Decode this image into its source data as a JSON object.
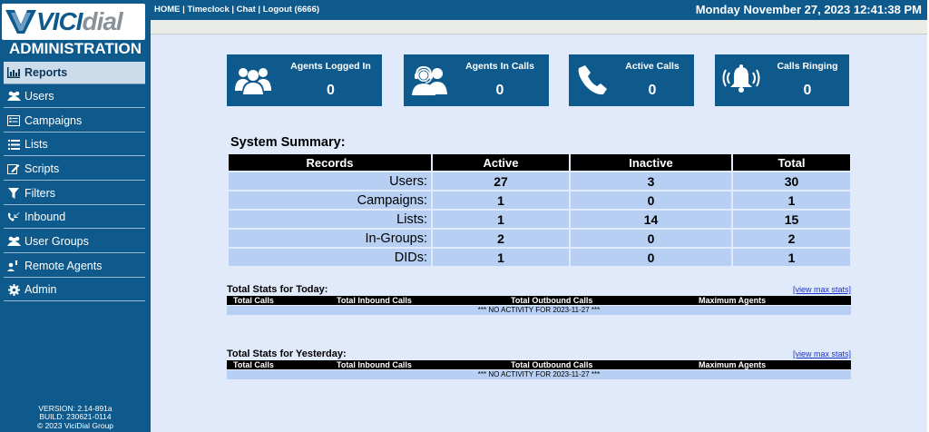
{
  "logo": {
    "brand_bold": "VICI",
    "brand_light": "dial"
  },
  "sidebar": {
    "title": "ADMINISTRATION",
    "items": [
      {
        "label": "Reports",
        "icon": "bar-chart-icon",
        "active": true
      },
      {
        "label": "Users",
        "icon": "users-icon"
      },
      {
        "label": "Campaigns",
        "icon": "campaigns-icon"
      },
      {
        "label": "Lists",
        "icon": "list-icon"
      },
      {
        "label": "Scripts",
        "icon": "script-edit-icon"
      },
      {
        "label": "Filters",
        "icon": "filter-icon"
      },
      {
        "label": "Inbound",
        "icon": "inbound-call-icon"
      },
      {
        "label": "User Groups",
        "icon": "users-icon"
      },
      {
        "label": "Remote Agents",
        "icon": "remote-agent-icon"
      },
      {
        "label": "Admin",
        "icon": "gear-icon"
      }
    ],
    "version": "VERSION: 2.14-891a",
    "build": "BUILD: 230621-0114",
    "copyright": "© 2023 ViciDial Group"
  },
  "topbar": {
    "links": [
      "HOME",
      "Timeclock",
      "Chat",
      "Logout (6666)"
    ],
    "separator": " | ",
    "datetime": "Monday November 27, 2023 12:41:38 PM"
  },
  "cards": [
    {
      "label": "Agents Logged In",
      "value": "0",
      "icon": "agents-group-icon"
    },
    {
      "label": "Agents In Calls",
      "value": "0",
      "icon": "headset-agents-icon"
    },
    {
      "label": "Active Calls",
      "value": "0",
      "icon": "phone-icon"
    },
    {
      "label": "Calls Ringing",
      "value": "0",
      "icon": "ringing-bell-icon"
    }
  ],
  "summary": {
    "title": "System Summary:",
    "headers": [
      "Records",
      "Active",
      "Inactive",
      "Total"
    ],
    "rows": [
      {
        "label": "Users:",
        "active": "27",
        "inactive": "3",
        "total": "30"
      },
      {
        "label": "Campaigns:",
        "active": "1",
        "inactive": "0",
        "total": "1"
      },
      {
        "label": "Lists:",
        "active": "1",
        "inactive": "14",
        "total": "15"
      },
      {
        "label": "In-Groups:",
        "active": "2",
        "inactive": "0",
        "total": "2"
      },
      {
        "label": "DIDs:",
        "active": "1",
        "inactive": "0",
        "total": "1"
      }
    ]
  },
  "today": {
    "title": "Total Stats for Today:",
    "link": "[view max stats]",
    "headers": [
      "Total Calls",
      "Total Inbound Calls",
      "Total Outbound Calls",
      "Maximum Agents"
    ],
    "message": "*** NO ACTIVITY FOR 2023-11-27 ***"
  },
  "yesterday": {
    "title": "Total Stats for Yesterday:",
    "link": "[view max stats]",
    "headers": [
      "Total Calls",
      "Total Inbound Calls",
      "Total Outbound Calls",
      "Maximum Agents"
    ],
    "message": "*** NO ACTIVITY FOR 2023-11-27 ***"
  },
  "colors": {
    "brand_blue": "#0f5a8c",
    "content_bg": "#e1eafa",
    "table_cell": "#b7cff2",
    "link_blue": "#1a33c9"
  }
}
